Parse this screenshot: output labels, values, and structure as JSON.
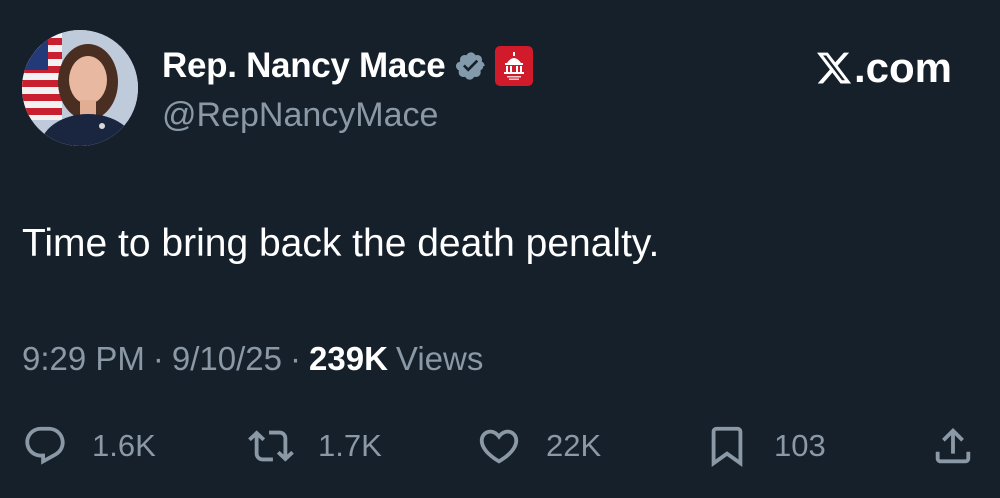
{
  "author": {
    "display_name": "Rep. Nancy Mace",
    "handle": "@RepNancyMace",
    "verified_icon": "verified-badge-icon",
    "affiliation_icon": "house-gop-capitol-icon"
  },
  "site": {
    "brand_letter": "X",
    "brand_suffix": ".com"
  },
  "tweet": {
    "text": "Time to bring back the death penalty."
  },
  "meta": {
    "time": "9:29 PM",
    "separator": "·",
    "date": "9/10/25",
    "views_count": "239K",
    "views_label": "Views"
  },
  "actions": {
    "reply": {
      "icon": "reply-icon",
      "count": "1.6K"
    },
    "repost": {
      "icon": "repost-icon",
      "count": "1.7K"
    },
    "like": {
      "icon": "heart-icon",
      "count": "22K"
    },
    "bookmark": {
      "icon": "bookmark-icon",
      "count": "103"
    },
    "share": {
      "icon": "share-icon"
    }
  },
  "colors": {
    "background": "#15202b",
    "primary_text": "#ffffff",
    "secondary_text": "#8b98a5",
    "verified_badge": "#829aab",
    "affiliation_badge": "#d11a2a"
  }
}
